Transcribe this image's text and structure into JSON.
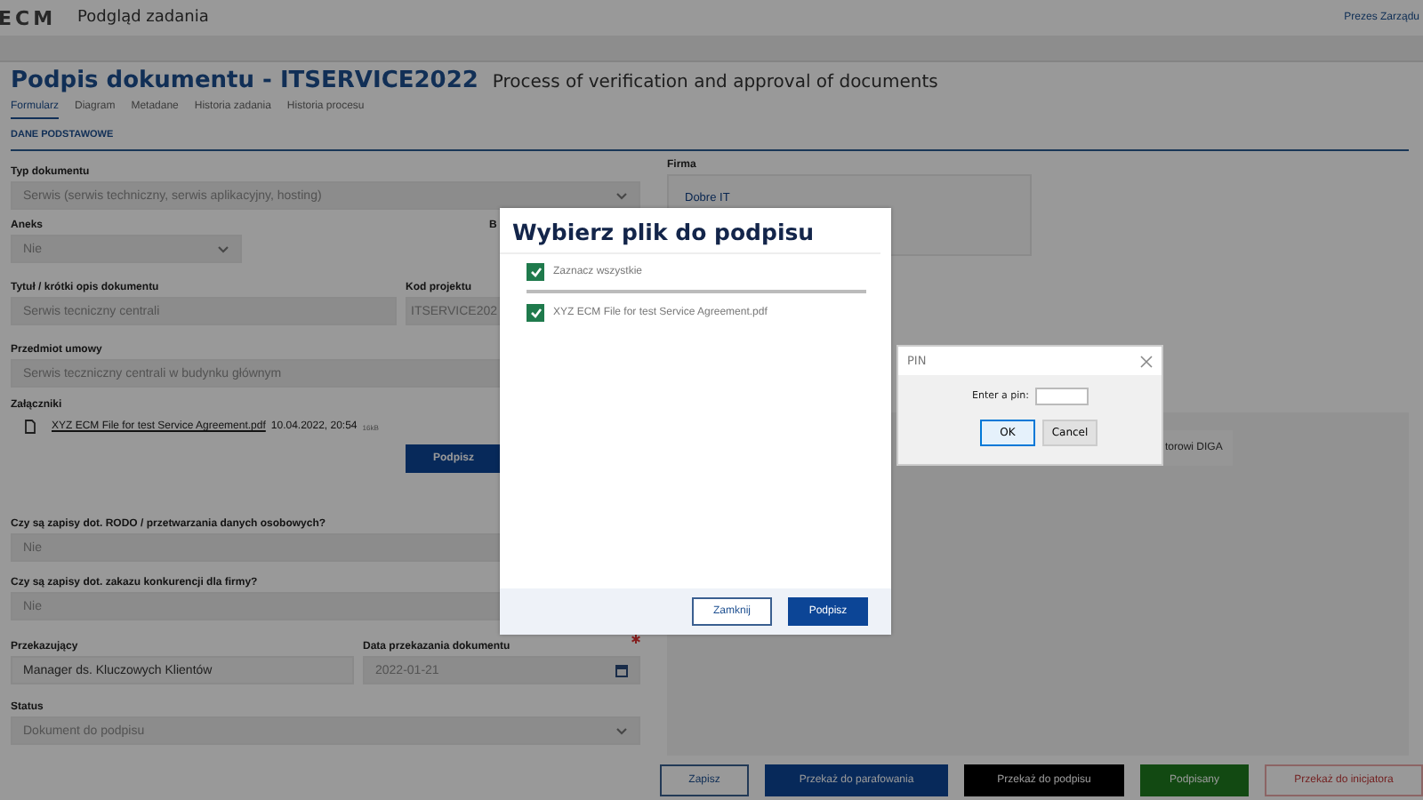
{
  "app": {
    "logo": "ECM",
    "title": "Podgląd zadania",
    "user": "Prezes Zarządu"
  },
  "task": {
    "title": "Podpis dokumentu - ITSERVICE2022",
    "subtitle": "Process of verification and approval of documents"
  },
  "tabs": [
    {
      "label": "Formularz",
      "selected": true
    },
    {
      "label": "Diagram",
      "selected": false
    },
    {
      "label": "Metadane",
      "selected": false
    },
    {
      "label": "Historia zadania",
      "selected": false
    },
    {
      "label": "Historia procesu",
      "selected": false
    }
  ],
  "section": "DANE PODSTAWOWE",
  "form_rows": [
    {
      "fields": [
        {
          "kind": "select",
          "label": "Typ dokumentu",
          "value": "Serwis (serwis techniczny, serwis aplikacyjny, hosting)",
          "disabled": true
        }
      ]
    },
    {
      "fields": [
        {
          "kind": "select",
          "label": "Aneks",
          "value": "Nie",
          "disabled": true
        },
        {
          "kind": "label",
          "label": "B"
        }
      ]
    },
    {
      "fields": [
        {
          "kind": "text",
          "label": "Tytuł / krótki opis dokumentu",
          "value": "Serwis tecniczny centrali",
          "disabled": true
        },
        {
          "kind": "text",
          "label": "Kod projektu",
          "value": "ITSERVICE202",
          "disabled": true
        }
      ]
    },
    {
      "fields": [
        {
          "kind": "text",
          "label": "Przedmiot umowy",
          "value": "Serwis teczniczny centrali w budynku głównym",
          "disabled": true
        }
      ]
    },
    {
      "fields": [
        {
          "kind": "attachments",
          "label": "Załączniki",
          "files": [
            {
              "name": "XYZ ECM File for test Service Agreement.pdf",
              "date": "10.04.2022, 20:54",
              "size": "16kB"
            }
          ],
          "button": "Podpisz"
        }
      ]
    },
    {
      "fields": [
        {
          "kind": "text",
          "label": "Czy są zapisy dot. RODO / przetwarzania danych osobowych?",
          "value": "Nie",
          "disabled": true
        }
      ]
    },
    {
      "fields": [
        {
          "kind": "text",
          "label": "Czy są zapisy dot. zakazu konkurencji dla firmy?",
          "value": "Nie",
          "disabled": true
        }
      ]
    },
    {
      "fields": [
        {
          "kind": "text",
          "label": "Przekazujący",
          "value": "Manager ds. Kluczowych Klientów",
          "disabled": false
        },
        {
          "kind": "date",
          "label": "Data przekazania dokumentu",
          "value": "2022-01-21",
          "disabled": true,
          "required": true
        }
      ]
    },
    {
      "fields": [
        {
          "kind": "select",
          "label": "Status",
          "value": "Dokument do podpisu",
          "disabled": true
        }
      ]
    }
  ],
  "side": {
    "company_label": "Firma",
    "company": "Dobre IT",
    "panel_text": "torowi DIGA"
  },
  "actions": [
    {
      "label": "Zapisz",
      "kind": "outline"
    },
    {
      "label": "Przekaż do parafowania",
      "kind": "primary"
    },
    {
      "label": "Przekaż do podpisu",
      "kind": "dark"
    },
    {
      "label": "Podpisany",
      "kind": "success"
    },
    {
      "label": "Przekaż do inicjatora",
      "kind": "danger"
    }
  ],
  "modal": {
    "title": "Wybierz plik do podpisu",
    "items": [
      {
        "kind": "select_all",
        "label": "Zaznacz wszystkie",
        "checked": true
      },
      {
        "kind": "file",
        "label": "XYZ ECM File for test Service Agreement.pdf",
        "checked": true
      }
    ],
    "buttons": [
      {
        "label": "Zamknij",
        "kind": "outline"
      },
      {
        "label": "Podpisz",
        "kind": "primary"
      }
    ]
  },
  "pin_dialog": {
    "title": "PIN",
    "prompt": "Enter a pin:",
    "buttons": [
      {
        "label": "OK",
        "default": true
      },
      {
        "label": "Cancel",
        "default": false
      }
    ]
  }
}
